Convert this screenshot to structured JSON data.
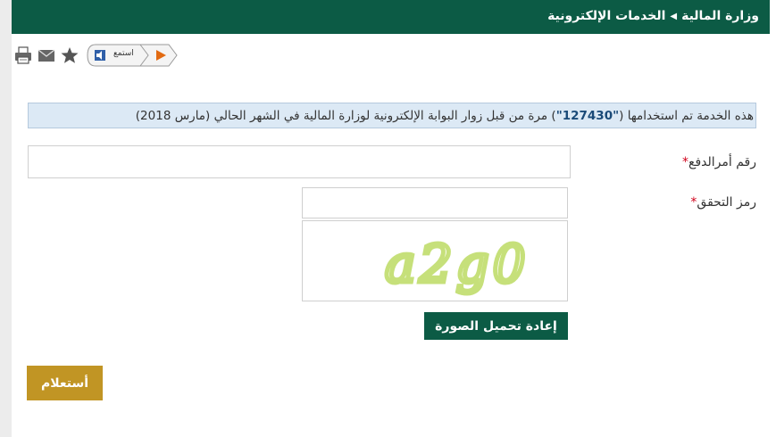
{
  "header": {
    "breadcrumb": [
      "وزارة المالية",
      "الخدمات الإلكترونية"
    ]
  },
  "toolbar": {
    "icons": [
      "print-icon",
      "email-icon",
      "star-icon"
    ],
    "listen_label": "استمع"
  },
  "usage": {
    "prefix": "هذه الخدمة تم استخدامها ( ",
    "count": "\"127430\"",
    "suffix": " ) مرة من قبل زوار البوابة الإلكترونية لوزارة المالية في الشهر الحالي (مارس 2018)"
  },
  "form": {
    "payment_order_label": "رقم أمرالدفع",
    "payment_order_value": "",
    "captcha_label": "رمز التحقق",
    "captcha_value": "",
    "required_marker": "*",
    "captcha_image_text": "a2g0",
    "reload_button": "إعادة تحميل الصورة",
    "submit_button": "أستعلام"
  },
  "colors": {
    "header_bg": "#0c5b45",
    "submit_bg": "#c19524",
    "captcha_text": "#c6e07a"
  }
}
